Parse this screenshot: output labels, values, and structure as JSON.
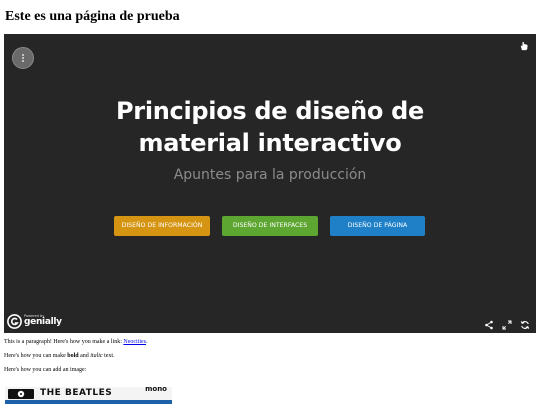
{
  "page": {
    "heading": "Este es una página de prueba"
  },
  "viewer": {
    "title_line1": "Principios de diseño de",
    "title_line2": "material interactivo",
    "subtitle": "Apuntes para la producción",
    "buttons": [
      {
        "label": "DISEÑO DE INFORMACIÓN",
        "color": "#d59412"
      },
      {
        "label": "DISEÑO DE INTERFACES",
        "color": "#5ea632"
      },
      {
        "label": "DISEÑO DE PÁGINA",
        "color": "#1f80c8"
      }
    ],
    "brand": {
      "small": "Powered by",
      "name": "genially"
    },
    "background": "#262626",
    "icons": {
      "menu": "more-vertical-icon",
      "corner": "cursor-hand-icon",
      "share": "share-icon",
      "fullscreen": "fullscreen-icon",
      "refresh": "refresh-icon"
    }
  },
  "content": {
    "paragraph1_text": "This is a paragraph! Here's how you make a link: ",
    "paragraph1_link": "Neocities",
    "paragraph1_end": ".",
    "paragraph2_start": "Here's how you can make ",
    "paragraph2_bold": "bold",
    "paragraph2_mid": " and ",
    "paragraph2_italic": "italic",
    "paragraph2_end": " text.",
    "paragraph3": "Here's how you can add an image:"
  },
  "album": {
    "title": "THE BEATLES",
    "tag": "mono"
  }
}
